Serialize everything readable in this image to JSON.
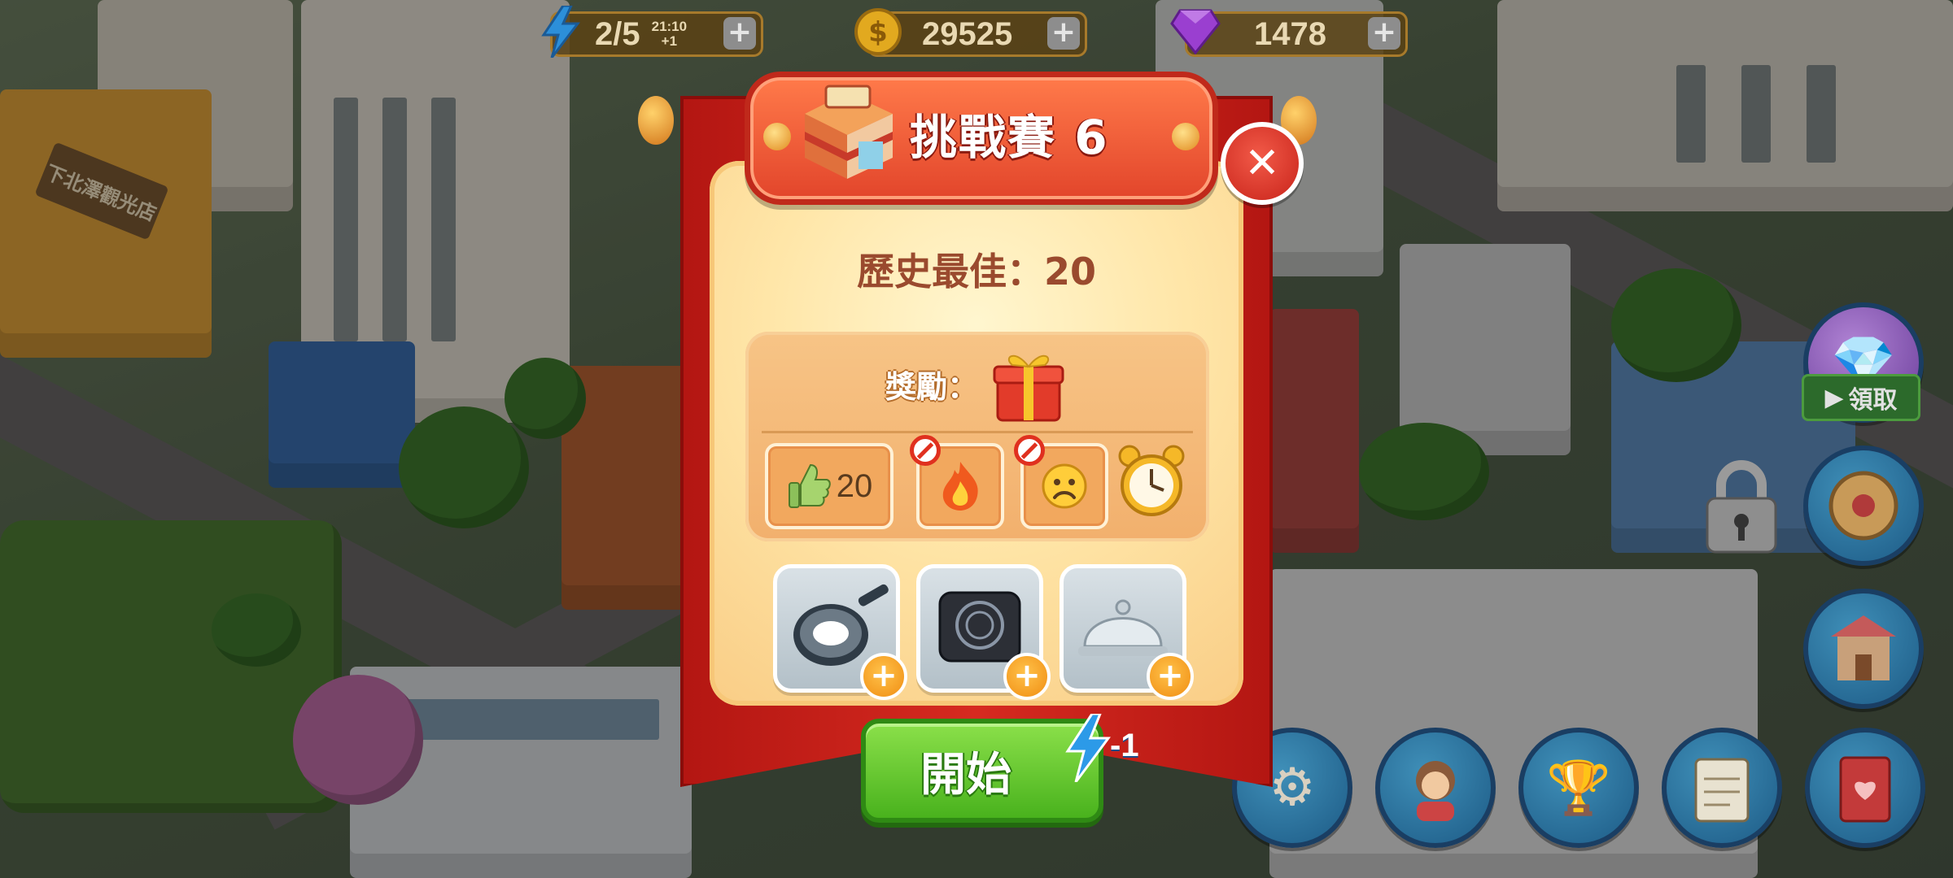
{
  "top_bar": {
    "energy": {
      "icon": "lightning-icon",
      "value": "2/5",
      "timer": "21:10",
      "regen": "+1"
    },
    "coins": {
      "icon": "coin-icon",
      "value": "29525"
    },
    "gems": {
      "icon": "gem-icon",
      "value": "1478"
    }
  },
  "scene": {
    "shop_sign": "下北澤觀光店"
  },
  "dialog": {
    "title": "挑戰賽 6",
    "best_score": "歷史最佳：20",
    "reward_label": "獎勵：",
    "conditions": [
      {
        "icon": "thumbs-up-icon",
        "value": "20",
        "forbidden": false
      },
      {
        "icon": "fire-icon",
        "value": "",
        "forbidden": true
      },
      {
        "icon": "sad-face-icon",
        "value": "",
        "forbidden": true
      },
      {
        "icon": "alarm-clock-icon",
        "value": "",
        "forbidden": false
      }
    ],
    "boosters": [
      {
        "icon": "frying-pan-icon"
      },
      {
        "icon": "induction-stove-icon"
      },
      {
        "icon": "serving-cloche-icon"
      }
    ],
    "start_label": "開始",
    "start_cost": "-1"
  },
  "side_buttons": {
    "claim_label": "領取",
    "items": [
      "gem-chest-icon",
      "lucky-wheel-icon",
      "shop-icon"
    ]
  },
  "bottom_buttons": [
    "settings-gear-icon",
    "profile-icon",
    "trophy-icon",
    "notepad-icon",
    "recipe-book-icon"
  ],
  "colors": {
    "banner_red": "#d62a20",
    "title_orange": "#e2452b",
    "start_green": "#49b21d",
    "plus_orange": "#f08d12"
  }
}
